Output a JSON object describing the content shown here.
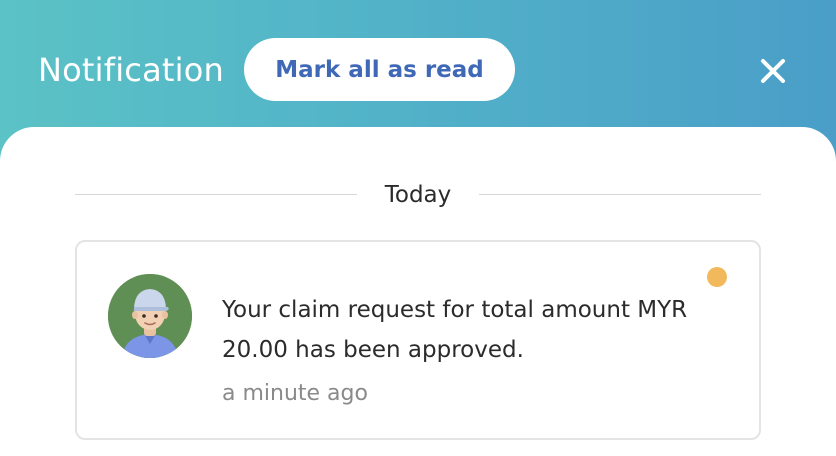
{
  "header": {
    "title": "Notification",
    "mark_all_label": "Mark all as read",
    "close_icon": "close-icon"
  },
  "section": {
    "label": "Today"
  },
  "notifications": [
    {
      "avatar_icon": "user-avatar",
      "message": "Your claim request for total amount MYR 20.00 has been approved.",
      "time": "a minute ago",
      "unread": true,
      "unread_color": "#f2b85c"
    }
  ],
  "colors": {
    "header_gradient_start": "#5bc2c6",
    "header_gradient_end": "#4a9ec8",
    "button_text": "#3f68b6",
    "unread_dot": "#f2b85c"
  }
}
